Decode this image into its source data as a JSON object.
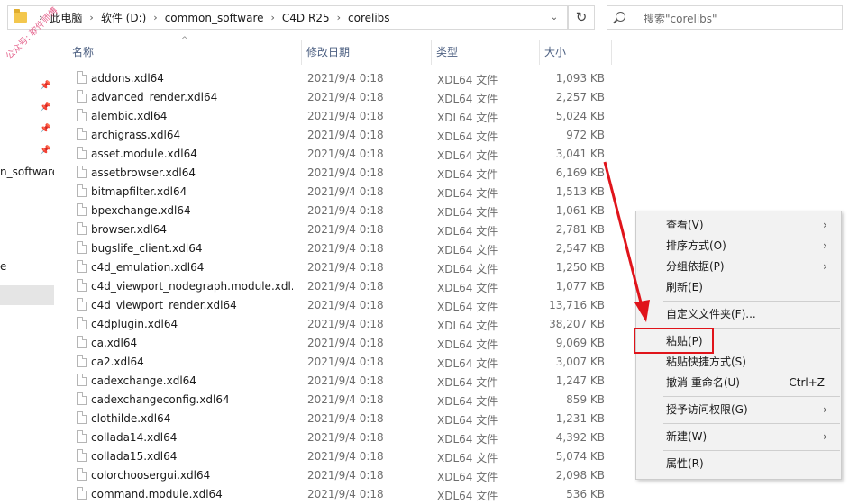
{
  "address": {
    "crumbs": [
      "此电脑",
      "软件 (D:)",
      "common_software",
      "C4D R25",
      "corelibs"
    ]
  },
  "search": {
    "placeholder": "搜索\"corelibs\""
  },
  "watermark": "公众号: 软件师傅",
  "nav": {
    "partial_item": "n_software",
    "partial_item2": "e"
  },
  "columns": {
    "name": "名称",
    "date": "修改日期",
    "type": "类型",
    "size": "大小"
  },
  "files": [
    {
      "name": "addons.xdl64",
      "date": "2021/9/4 0:18",
      "type": "XDL64 文件",
      "size": "1,093 KB"
    },
    {
      "name": "advanced_render.xdl64",
      "date": "2021/9/4 0:18",
      "type": "XDL64 文件",
      "size": "2,257 KB"
    },
    {
      "name": "alembic.xdl64",
      "date": "2021/9/4 0:18",
      "type": "XDL64 文件",
      "size": "5,024 KB"
    },
    {
      "name": "archigrass.xdl64",
      "date": "2021/9/4 0:18",
      "type": "XDL64 文件",
      "size": "972 KB"
    },
    {
      "name": "asset.module.xdl64",
      "date": "2021/9/4 0:18",
      "type": "XDL64 文件",
      "size": "3,041 KB"
    },
    {
      "name": "assetbrowser.xdl64",
      "date": "2021/9/4 0:18",
      "type": "XDL64 文件",
      "size": "6,169 KB"
    },
    {
      "name": "bitmapfilter.xdl64",
      "date": "2021/9/4 0:18",
      "type": "XDL64 文件",
      "size": "1,513 KB"
    },
    {
      "name": "bpexchange.xdl64",
      "date": "2021/9/4 0:18",
      "type": "XDL64 文件",
      "size": "1,061 KB"
    },
    {
      "name": "browser.xdl64",
      "date": "2021/9/4 0:18",
      "type": "XDL64 文件",
      "size": "2,781 KB"
    },
    {
      "name": "bugslife_client.xdl64",
      "date": "2021/9/4 0:18",
      "type": "XDL64 文件",
      "size": "2,547 KB"
    },
    {
      "name": "c4d_emulation.xdl64",
      "date": "2021/9/4 0:18",
      "type": "XDL64 文件",
      "size": "1,250 KB"
    },
    {
      "name": "c4d_viewport_nodegraph.module.xdl...",
      "date": "2021/9/4 0:18",
      "type": "XDL64 文件",
      "size": "1,077 KB"
    },
    {
      "name": "c4d_viewport_render.xdl64",
      "date": "2021/9/4 0:18",
      "type": "XDL64 文件",
      "size": "13,716 KB"
    },
    {
      "name": "c4dplugin.xdl64",
      "date": "2021/9/4 0:18",
      "type": "XDL64 文件",
      "size": "38,207 KB"
    },
    {
      "name": "ca.xdl64",
      "date": "2021/9/4 0:18",
      "type": "XDL64 文件",
      "size": "9,069 KB"
    },
    {
      "name": "ca2.xdl64",
      "date": "2021/9/4 0:18",
      "type": "XDL64 文件",
      "size": "3,007 KB"
    },
    {
      "name": "cadexchange.xdl64",
      "date": "2021/9/4 0:18",
      "type": "XDL64 文件",
      "size": "1,247 KB"
    },
    {
      "name": "cadexchangeconfig.xdl64",
      "date": "2021/9/4 0:18",
      "type": "XDL64 文件",
      "size": "859 KB"
    },
    {
      "name": "clothilde.xdl64",
      "date": "2021/9/4 0:18",
      "type": "XDL64 文件",
      "size": "1,231 KB"
    },
    {
      "name": "collada14.xdl64",
      "date": "2021/9/4 0:18",
      "type": "XDL64 文件",
      "size": "4,392 KB"
    },
    {
      "name": "collada15.xdl64",
      "date": "2021/9/4 0:18",
      "type": "XDL64 文件",
      "size": "5,074 KB"
    },
    {
      "name": "colorchoosergui.xdl64",
      "date": "2021/9/4 0:18",
      "type": "XDL64 文件",
      "size": "2,098 KB"
    },
    {
      "name": "command.module.xdl64",
      "date": "2021/9/4 0:18",
      "type": "XDL64 文件",
      "size": "536 KB"
    }
  ],
  "menu": {
    "view": "查看(V)",
    "sort": "排序方式(O)",
    "group": "分组依据(P)",
    "refresh": "刷新(E)",
    "customize": "自定义文件夹(F)...",
    "paste": "粘贴(P)",
    "paste_shortcut": "粘贴快捷方式(S)",
    "undo_rename": "撤消 重命名(U)",
    "undo_shortcut": "Ctrl+Z",
    "grant_access": "授予访问权限(G)",
    "new": "新建(W)",
    "properties": "属性(R)"
  },
  "colors": {
    "highlight": "#e0141b",
    "menu_bg": "#f2f2f2",
    "header_text": "#4d6082"
  }
}
